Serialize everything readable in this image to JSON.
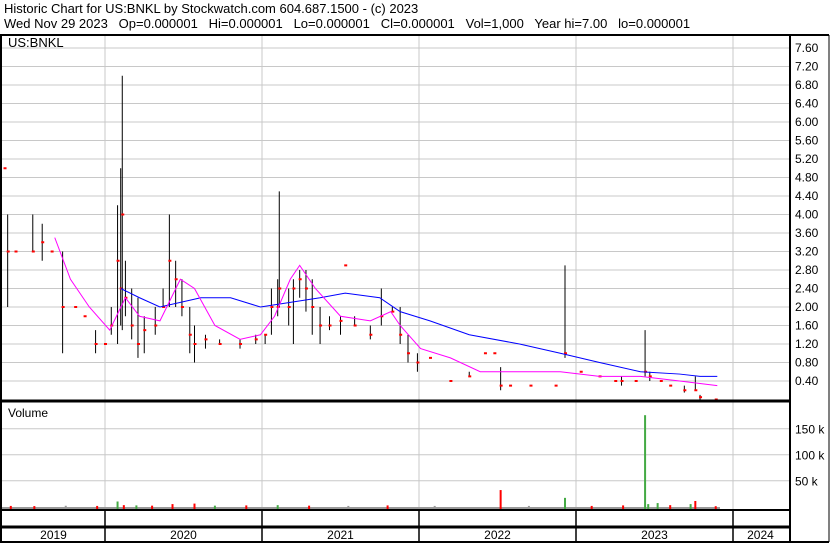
{
  "header": {
    "line1": "Historic Chart for US:BNKL by Stockwatch.com 604.687.1500 - (c) 2023",
    "line2": "Wed Nov 29 2023   Op=0.000001   Hi=0.000001   Lo=0.000001   Cl=0.000001   Vol=1,000   Year hi=7.00   lo=0.000001"
  },
  "colors": {
    "down": "#ff0000",
    "up": "#44aa44",
    "ma_long": "#0000ff",
    "ma_short": "#ff00ff",
    "grid": "#c8c8c8",
    "flat": "#999999"
  },
  "chart_data": [
    {
      "type": "ohlc",
      "title": "US:BNKL",
      "ylim": [
        0,
        7.8
      ],
      "xlim": [
        2019.33,
        2024.35
      ],
      "yticks": [
        "0.40",
        "0.80",
        "1.20",
        "1.60",
        "2.00",
        "2.40",
        "2.80",
        "3.20",
        "3.60",
        "4.00",
        "4.40",
        "4.80",
        "5.20",
        "5.60",
        "6.00",
        "6.40",
        "6.80",
        "7.20",
        "7.60"
      ],
      "bars": [
        [
          2019.36,
          5.0,
          5.0,
          5.0
        ],
        [
          2019.38,
          4.0,
          2.0,
          3.2
        ],
        [
          2019.43,
          3.2,
          3.2,
          3.2
        ],
        [
          2019.54,
          4.0,
          3.2,
          3.2
        ],
        [
          2019.6,
          3.8,
          3.0,
          3.4
        ],
        [
          2019.66,
          3.2,
          3.2,
          3.2
        ],
        [
          2019.73,
          3.2,
          1.0,
          2.0
        ],
        [
          2019.81,
          2.0,
          2.0,
          2.0
        ],
        [
          2019.87,
          1.8,
          1.8,
          1.8
        ],
        [
          2019.94,
          1.5,
          1.0,
          1.2
        ],
        [
          2020.0,
          1.2,
          1.2,
          1.2
        ],
        [
          2020.04,
          2.0,
          1.4,
          1.6
        ],
        [
          2020.08,
          4.2,
          1.2,
          3.0
        ],
        [
          2020.1,
          5.0,
          1.6,
          2.4
        ],
        [
          2020.11,
          7.0,
          1.5,
          4.0
        ],
        [
          2020.13,
          3.0,
          1.8,
          2.2
        ],
        [
          2020.17,
          2.4,
          1.3,
          1.6
        ],
        [
          2020.21,
          2.2,
          0.9,
          1.2
        ],
        [
          2020.25,
          1.8,
          1.0,
          1.5
        ],
        [
          2020.32,
          2.0,
          1.4,
          1.6
        ],
        [
          2020.37,
          2.4,
          2.0,
          2.0
        ],
        [
          2020.41,
          4.0,
          2.0,
          3.0
        ],
        [
          2020.45,
          3.0,
          2.0,
          2.6
        ],
        [
          2020.49,
          2.6,
          1.8,
          2.0
        ],
        [
          2020.54,
          2.0,
          1.0,
          1.4
        ],
        [
          2020.57,
          1.6,
          0.8,
          1.2
        ],
        [
          2020.64,
          1.4,
          1.1,
          1.3
        ],
        [
          2020.73,
          1.3,
          1.2,
          1.2
        ],
        [
          2020.86,
          1.3,
          1.1,
          1.2
        ],
        [
          2020.96,
          1.4,
          1.2,
          1.3
        ],
        [
          2021.02,
          1.4,
          1.2,
          1.4
        ],
        [
          2021.06,
          2.4,
          1.4,
          2.0
        ],
        [
          2021.1,
          2.6,
          1.8,
          2.0
        ],
        [
          2021.11,
          4.5,
          2.0,
          2.4
        ],
        [
          2021.17,
          2.4,
          1.6,
          2.0
        ],
        [
          2021.2,
          2.6,
          1.2,
          2.4
        ],
        [
          2021.24,
          2.8,
          2.2,
          2.6
        ],
        [
          2021.28,
          2.8,
          1.9,
          2.4
        ],
        [
          2021.32,
          2.6,
          1.4,
          2.0
        ],
        [
          2021.37,
          2.0,
          1.2,
          1.6
        ],
        [
          2021.43,
          1.8,
          1.5,
          1.6
        ],
        [
          2021.5,
          1.8,
          1.4,
          1.7
        ],
        [
          2021.53,
          2.9,
          2.9,
          2.9
        ],
        [
          2021.59,
          1.8,
          1.6,
          1.6
        ],
        [
          2021.69,
          1.6,
          1.3,
          1.4
        ],
        [
          2021.76,
          2.4,
          1.6,
          1.8
        ],
        [
          2021.83,
          2.0,
          1.9,
          1.9
        ],
        [
          2021.88,
          2.0,
          1.2,
          1.4
        ],
        [
          2021.93,
          1.4,
          0.8,
          1.0
        ],
        [
          2021.99,
          1.0,
          0.6,
          0.8
        ],
        [
          2022.07,
          0.9,
          0.9,
          0.9
        ],
        [
          2022.2,
          0.4,
          0.4,
          0.4
        ],
        [
          2022.32,
          0.6,
          0.5,
          0.5
        ],
        [
          2022.42,
          1.0,
          1.0,
          1.0
        ],
        [
          2022.48,
          1.0,
          1.0,
          1.0
        ],
        [
          2022.52,
          0.7,
          0.2,
          0.3
        ],
        [
          2022.58,
          0.3,
          0.3,
          0.3
        ],
        [
          2022.71,
          0.3,
          0.3,
          0.3
        ],
        [
          2022.87,
          0.3,
          0.3,
          0.3
        ],
        [
          2022.93,
          2.9,
          0.9,
          1.0
        ],
        [
          2023.03,
          0.6,
          0.6,
          0.6
        ],
        [
          2023.15,
          0.5,
          0.5,
          0.5
        ],
        [
          2023.25,
          0.4,
          0.4,
          0.4
        ],
        [
          2023.29,
          0.5,
          0.3,
          0.4
        ],
        [
          2023.38,
          0.4,
          0.4,
          0.4
        ],
        [
          2023.44,
          1.5,
          0.5,
          0.6
        ],
        [
          2023.47,
          0.6,
          0.4,
          0.5
        ],
        [
          2023.54,
          0.4,
          0.4,
          0.4
        ],
        [
          2023.6,
          0.3,
          0.3,
          0.3
        ],
        [
          2023.69,
          0.3,
          0.15,
          0.2
        ],
        [
          2023.76,
          0.5,
          0.2,
          0.2
        ],
        [
          2023.79,
          0.1,
          0.0,
          0.05
        ],
        [
          2023.89,
          0.0,
          0.0,
          0.0
        ]
      ],
      "ma_long": [
        [
          2020.1,
          2.4
        ],
        [
          2020.22,
          2.2
        ],
        [
          2020.35,
          2.0
        ],
        [
          2020.48,
          2.1
        ],
        [
          2020.61,
          2.2
        ],
        [
          2020.8,
          2.2
        ],
        [
          2020.99,
          2.0
        ],
        [
          2021.18,
          2.1
        ],
        [
          2021.37,
          2.2
        ],
        [
          2021.53,
          2.3
        ],
        [
          2021.75,
          2.2
        ],
        [
          2021.88,
          1.9
        ],
        [
          2022.07,
          1.7
        ],
        [
          2022.32,
          1.4
        ],
        [
          2022.64,
          1.2
        ],
        [
          2022.9,
          1.0
        ],
        [
          2023.15,
          0.8
        ],
        [
          2023.41,
          0.6
        ],
        [
          2023.66,
          0.55
        ],
        [
          2023.79,
          0.5
        ],
        [
          2023.9,
          0.5
        ]
      ],
      "ma_short": [
        [
          2019.68,
          3.5
        ],
        [
          2019.78,
          2.6
        ],
        [
          2019.9,
          2.0
        ],
        [
          2020.03,
          1.5
        ],
        [
          2020.13,
          2.2
        ],
        [
          2020.22,
          1.8
        ],
        [
          2020.35,
          1.7
        ],
        [
          2020.48,
          2.6
        ],
        [
          2020.57,
          2.4
        ],
        [
          2020.7,
          1.6
        ],
        [
          2020.86,
          1.3
        ],
        [
          2020.99,
          1.4
        ],
        [
          2021.08,
          1.8
        ],
        [
          2021.18,
          2.6
        ],
        [
          2021.24,
          2.9
        ],
        [
          2021.34,
          2.4
        ],
        [
          2021.5,
          1.8
        ],
        [
          2021.69,
          1.7
        ],
        [
          2021.82,
          1.9
        ],
        [
          2021.88,
          1.6
        ],
        [
          2022.01,
          1.1
        ],
        [
          2022.2,
          0.9
        ],
        [
          2022.39,
          0.6
        ],
        [
          2022.64,
          0.6
        ],
        [
          2022.9,
          0.6
        ],
        [
          2023.15,
          0.5
        ],
        [
          2023.41,
          0.5
        ],
        [
          2023.66,
          0.4
        ],
        [
          2023.9,
          0.3
        ]
      ]
    },
    {
      "type": "bar",
      "title": "Volume",
      "ylim": [
        0,
        200000
      ],
      "yticks": [
        {
          "v": 50000,
          "label": "50 k"
        },
        {
          "v": 100000,
          "label": "100 k"
        },
        {
          "v": 150000,
          "label": "150 k"
        }
      ],
      "volume": [
        [
          2019.4,
          1500,
          "down"
        ],
        [
          2019.55,
          1200,
          "down"
        ],
        [
          2019.75,
          1800,
          "flat"
        ],
        [
          2019.95,
          1500,
          "down"
        ],
        [
          2020.08,
          10000,
          "up"
        ],
        [
          2020.12,
          3000,
          "down"
        ],
        [
          2020.2,
          2500,
          "up"
        ],
        [
          2020.3,
          2000,
          "down"
        ],
        [
          2020.43,
          5000,
          "down"
        ],
        [
          2020.57,
          6000,
          "down"
        ],
        [
          2020.7,
          2000,
          "up"
        ],
        [
          2020.9,
          2500,
          "down"
        ],
        [
          2021.1,
          3000,
          "up"
        ],
        [
          2021.3,
          2000,
          "down"
        ],
        [
          2021.55,
          1500,
          "flat"
        ],
        [
          2021.8,
          2500,
          "down"
        ],
        [
          2022.1,
          1500,
          "flat"
        ],
        [
          2022.52,
          32000,
          "down"
        ],
        [
          2022.7,
          1500,
          "flat"
        ],
        [
          2022.93,
          17000,
          "up"
        ],
        [
          2023.1,
          1500,
          "down"
        ],
        [
          2023.3,
          2500,
          "down"
        ],
        [
          2023.44,
          176000,
          "up"
        ],
        [
          2023.46,
          5000,
          "up"
        ],
        [
          2023.52,
          7000,
          "up"
        ],
        [
          2023.6,
          3000,
          "down"
        ],
        [
          2023.73,
          5000,
          "up"
        ],
        [
          2023.76,
          11000,
          "down"
        ],
        [
          2023.89,
          1000,
          "down"
        ]
      ]
    },
    {
      "x_labels": [
        "2019",
        "2020",
        "2021",
        "2022",
        "2023",
        "2024"
      ]
    }
  ]
}
